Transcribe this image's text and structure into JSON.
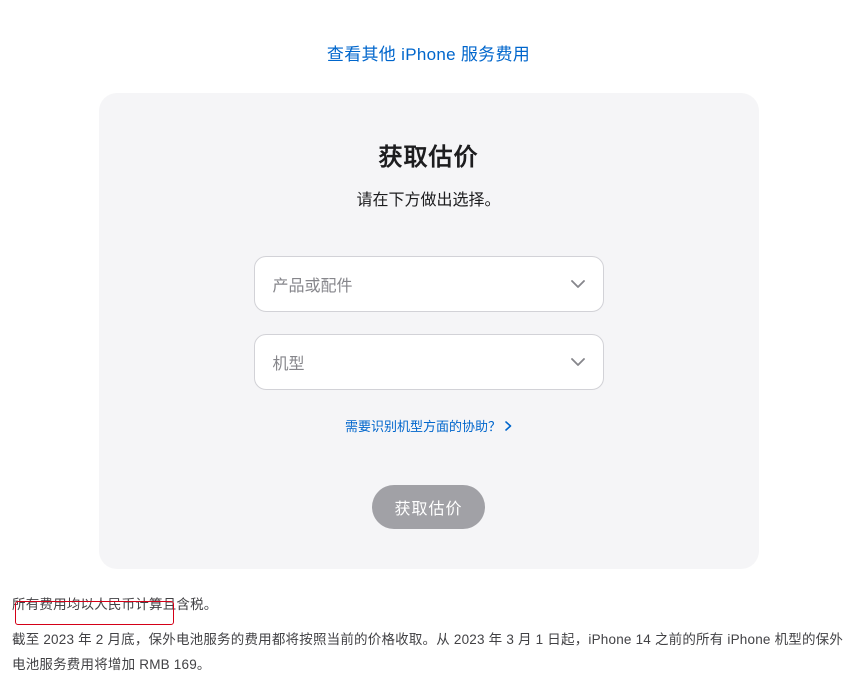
{
  "top_link": "查看其他 iPhone 服务费用",
  "card": {
    "title": "获取估价",
    "subtitle": "请在下方做出选择。",
    "select_product_placeholder": "产品或配件",
    "select_model_placeholder": "机型",
    "help_link": "需要识别机型方面的协助？",
    "submit": "获取估价"
  },
  "footer": {
    "line1": "所有费用均以人民币计算且含税。",
    "line2": "截至 2023 年 2 月底，保外电池服务的费用都将按照当前的价格收取。从 2023 年 3 月 1 日起，iPhone 14 之前的所有 iPhone 机型的保外电池服务费用将增加 RMB 169。"
  }
}
